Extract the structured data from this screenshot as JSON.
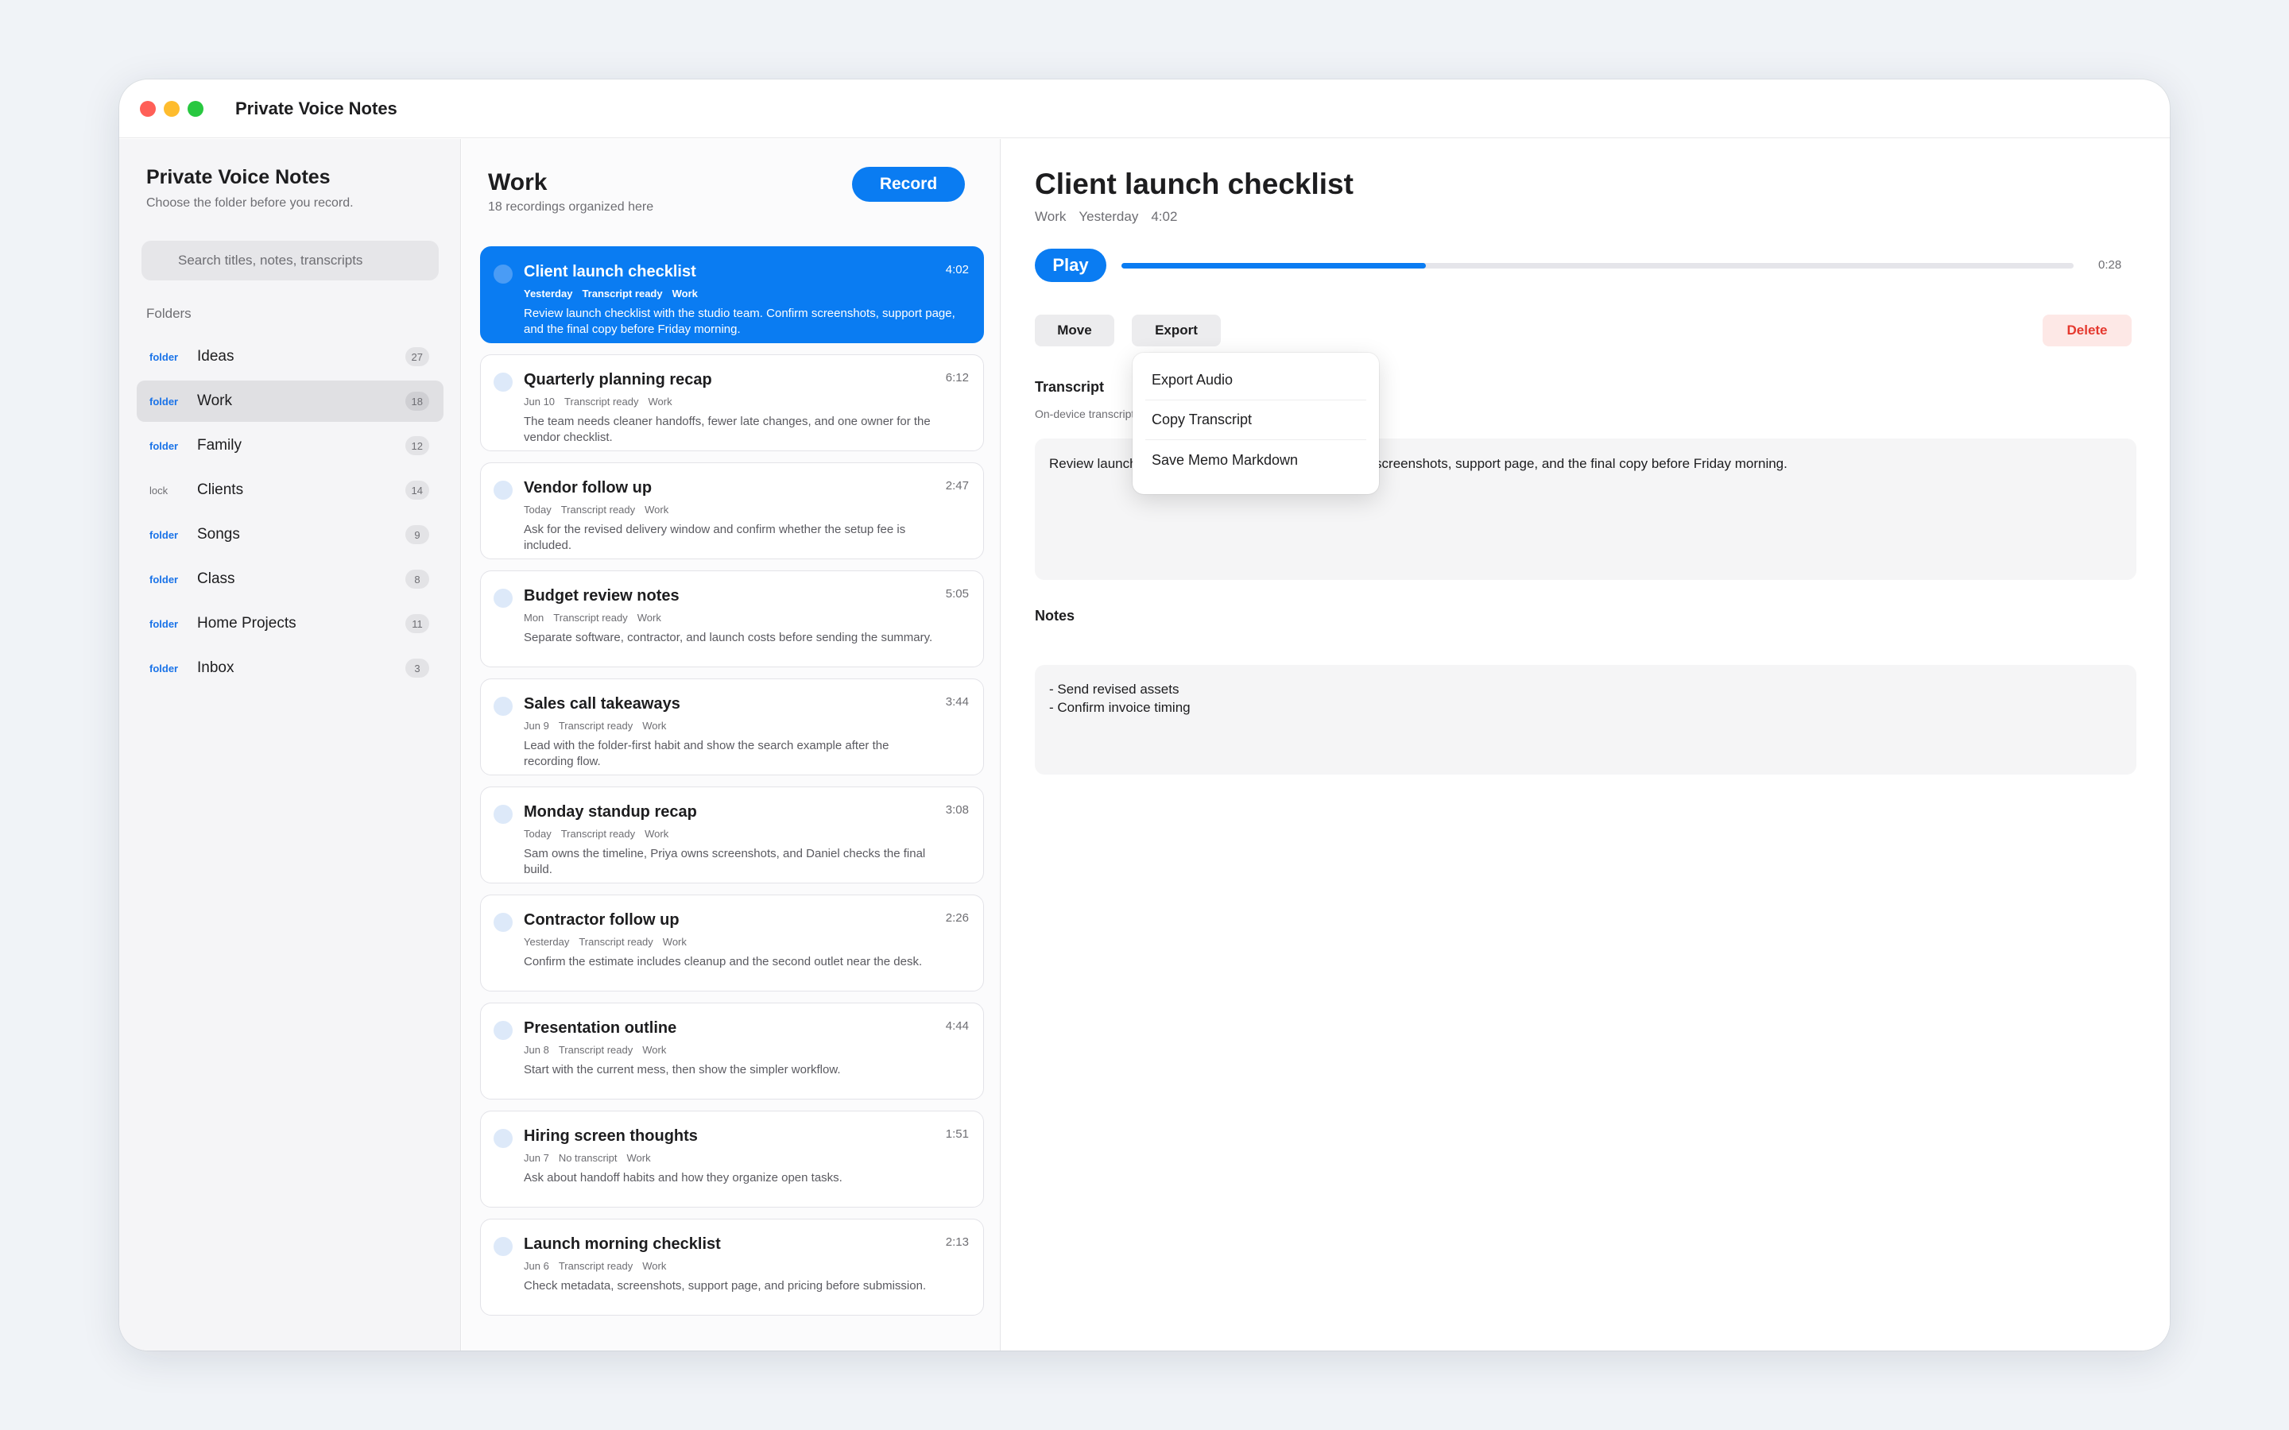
{
  "window": {
    "title": "Private Voice Notes"
  },
  "sidebar": {
    "title": "Private Voice Notes",
    "subtitle": "Choose the folder before you record.",
    "search_placeholder": "Search titles, notes, transcripts",
    "folders_label": "Folders",
    "folders": [
      {
        "tag": "folder",
        "name": "Ideas",
        "count": "27",
        "selected": false
      },
      {
        "tag": "folder",
        "name": "Work",
        "count": "18",
        "selected": true
      },
      {
        "tag": "folder",
        "name": "Family",
        "count": "12",
        "selected": false
      },
      {
        "tag": "lock",
        "name": "Clients",
        "count": "14",
        "selected": false
      },
      {
        "tag": "folder",
        "name": "Songs",
        "count": "9",
        "selected": false
      },
      {
        "tag": "folder",
        "name": "Class",
        "count": "8",
        "selected": false
      },
      {
        "tag": "folder",
        "name": "Home Projects",
        "count": "11",
        "selected": false
      },
      {
        "tag": "folder",
        "name": "Inbox",
        "count": "3",
        "selected": false
      }
    ]
  },
  "list": {
    "title": "Work",
    "subtitle": "18 recordings organized here",
    "record_label": "Record",
    "memos": [
      {
        "title": "Client launch checklist",
        "duration": "4:02",
        "date": "Yesterday",
        "status": "Transcript ready",
        "folder": "Work",
        "snippet": "Review launch checklist with the studio team. Confirm screenshots, support page, and the final copy before Friday morning.",
        "selected": true
      },
      {
        "title": "Quarterly planning recap",
        "duration": "6:12",
        "date": "Jun 10",
        "status": "Transcript ready",
        "folder": "Work",
        "snippet": "The team needs cleaner handoffs, fewer late changes, and one owner for the vendor checklist.",
        "selected": false
      },
      {
        "title": "Vendor follow up",
        "duration": "2:47",
        "date": "Today",
        "status": "Transcript ready",
        "folder": "Work",
        "snippet": "Ask for the revised delivery window and confirm whether the setup fee is included.",
        "selected": false
      },
      {
        "title": "Budget review notes",
        "duration": "5:05",
        "date": "Mon",
        "status": "Transcript ready",
        "folder": "Work",
        "snippet": "Separate software, contractor, and launch costs before sending the summary.",
        "selected": false
      },
      {
        "title": "Sales call takeaways",
        "duration": "3:44",
        "date": "Jun 9",
        "status": "Transcript ready",
        "folder": "Work",
        "snippet": "Lead with the folder-first habit and show the search example after the recording flow.",
        "selected": false
      },
      {
        "title": "Monday standup recap",
        "duration": "3:08",
        "date": "Today",
        "status": "Transcript ready",
        "folder": "Work",
        "snippet": "Sam owns the timeline, Priya owns screenshots, and Daniel checks the final build.",
        "selected": false
      },
      {
        "title": "Contractor follow up",
        "duration": "2:26",
        "date": "Yesterday",
        "status": "Transcript ready",
        "folder": "Work",
        "snippet": "Confirm the estimate includes cleanup and the second outlet near the desk.",
        "selected": false
      },
      {
        "title": "Presentation outline",
        "duration": "4:44",
        "date": "Jun 8",
        "status": "Transcript ready",
        "folder": "Work",
        "snippet": "Start with the current mess, then show the simpler workflow.",
        "selected": false
      },
      {
        "title": "Hiring screen thoughts",
        "duration": "1:51",
        "date": "Jun 7",
        "status": "No transcript",
        "folder": "Work",
        "snippet": "Ask about handoff habits and how they organize open tasks.",
        "selected": false
      },
      {
        "title": "Launch morning checklist",
        "duration": "2:13",
        "date": "Jun 6",
        "status": "Transcript ready",
        "folder": "Work",
        "snippet": "Check metadata, screenshots, support page, and pricing before submission.",
        "selected": false
      }
    ]
  },
  "detail": {
    "title": "Client launch checklist",
    "folder": "Work",
    "date": "Yesterday",
    "duration": "4:02",
    "play_label": "Play",
    "progress_fraction": 0.32,
    "elapsed_time": "0:28",
    "move_label": "Move",
    "export_label": "Export",
    "delete_label": "Delete",
    "transcript_label": "Transcript",
    "transcript_sub": "On-device transcript",
    "transcript_text": "Review launch checklist with the studio team. Confirm screenshots, support page, and the final copy before Friday morning.",
    "notes_label": "Notes",
    "notes_lines": [
      "- Send revised assets",
      "- Confirm invoice timing"
    ]
  },
  "export_menu": {
    "items": [
      "Export Audio",
      "Copy Transcript",
      "Save Memo Markdown"
    ]
  },
  "colors": {
    "accent": "#0a7cf2",
    "danger": "#e5382e",
    "danger_bg": "#fde8e6"
  }
}
